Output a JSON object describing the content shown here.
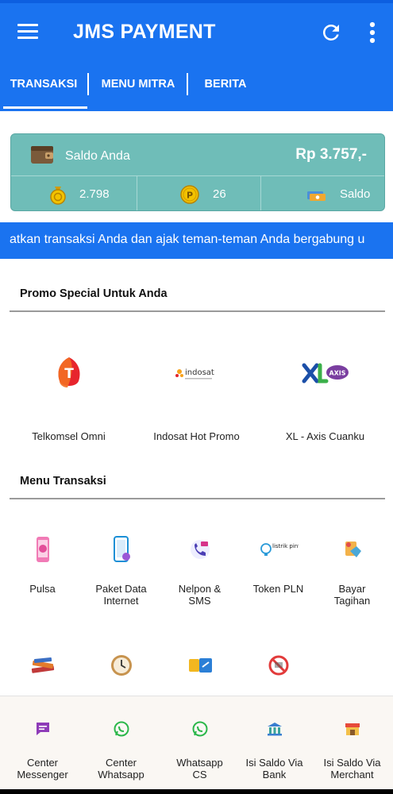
{
  "app": {
    "title": "JMS PAYMENT",
    "accent": "#1a73f0",
    "teal": "#6fbdb8"
  },
  "tabs": [
    {
      "label": "TRANSAKSI",
      "active": true
    },
    {
      "label": "MENU MITRA",
      "active": false
    },
    {
      "label": "BERITA",
      "active": false
    }
  ],
  "saldo": {
    "label": "Saldo Anda",
    "value": "Rp 3.757,-",
    "coins": "2.798",
    "points": "26",
    "saldo_label": "Saldo"
  },
  "marquee": {
    "text": "atkan transaksi Anda dan ajak teman-teman Anda bergabung u"
  },
  "promo": {
    "title": "Promo Special Untuk Anda",
    "items": [
      {
        "label": "Telkomsel Omni",
        "icon": "telkomsel-logo"
      },
      {
        "label": "Indosat Hot Promo",
        "icon": "indosat-logo",
        "brand_text": "indosat"
      },
      {
        "label": "XL - Axis Cuanku",
        "icon": "xl-axis-logo",
        "brand_text": "AXIS"
      }
    ]
  },
  "menu": {
    "title": "Menu Transaksi",
    "items": [
      {
        "label": "Pulsa",
        "icon": "phone-icon"
      },
      {
        "label": "Paket Data\nInternet",
        "icon": "smartphone-data-icon"
      },
      {
        "label": "Nelpon &\nSMS",
        "icon": "call-sms-icon"
      },
      {
        "label": "Token PLN",
        "icon": "lightbulb-icon",
        "brand_text": "listrik pintar"
      },
      {
        "label": "Bayar\nTagihan",
        "icon": "bill-icon"
      },
      {
        "label": "",
        "icon": "books-icon"
      },
      {
        "label": "",
        "icon": "clock-icon"
      },
      {
        "label": "",
        "icon": "cards-icon"
      },
      {
        "label": "",
        "icon": "no-sign-icon"
      }
    ]
  },
  "bottom_nav": [
    {
      "label": "Center\nMessenger",
      "icon": "message-icon"
    },
    {
      "label": "Center\nWhatsapp",
      "icon": "whatsapp-icon"
    },
    {
      "label": "Whatsapp\nCS",
      "icon": "whatsapp-icon"
    },
    {
      "label": "Isi Saldo Via\nBank",
      "icon": "bank-icon"
    },
    {
      "label": "Isi Saldo Via\nMerchant",
      "icon": "merchant-icon"
    }
  ]
}
